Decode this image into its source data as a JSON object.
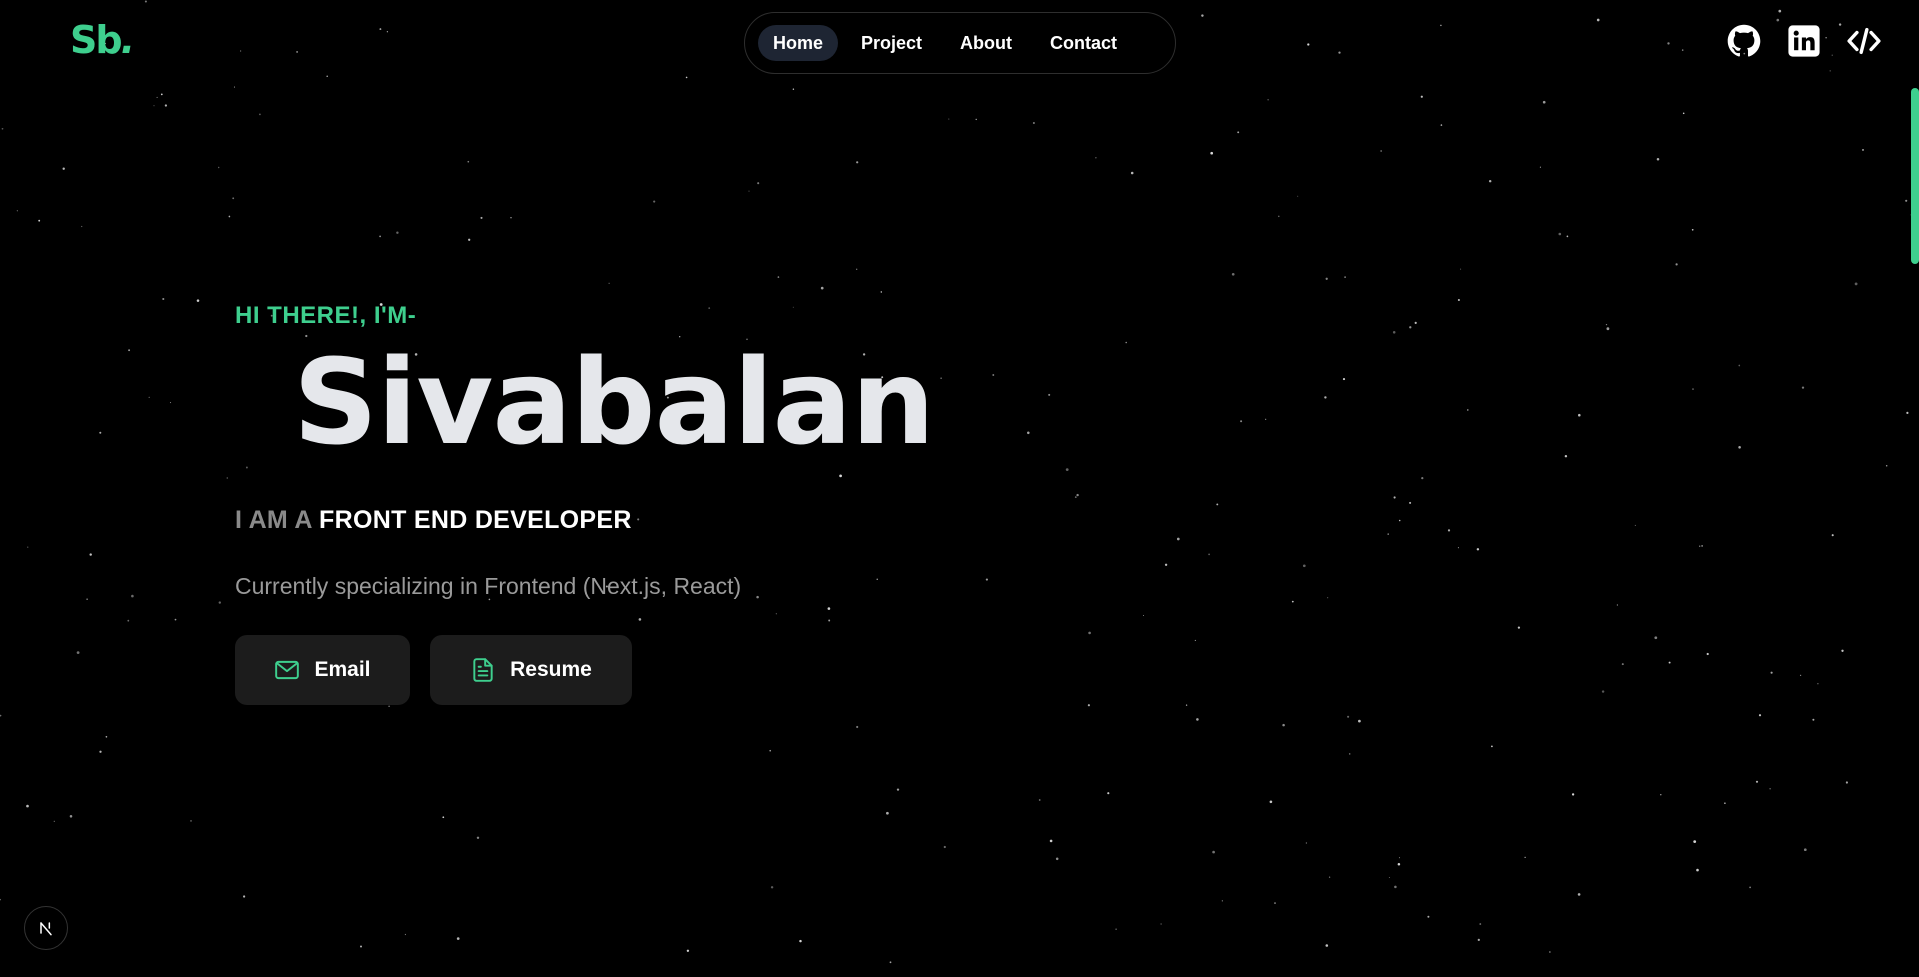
{
  "logo": {
    "text": "Sb",
    "dot": "."
  },
  "nav": {
    "items": [
      {
        "label": "Home",
        "active": true
      },
      {
        "label": "Project",
        "active": false
      },
      {
        "label": "About",
        "active": false
      },
      {
        "label": "Contact",
        "active": false
      }
    ]
  },
  "socials": [
    {
      "icon": "github-icon"
    },
    {
      "icon": "linkedin-icon"
    },
    {
      "icon": "code-icon"
    }
  ],
  "hero": {
    "greeting": "HI THERE!, I'M-",
    "name": "Sivabalan",
    "role_prefix": "I AM A",
    "role_title": "FRONT END DEVELOPER",
    "tagline": "Currently specializing in Frontend (Next.js, React)"
  },
  "buttons": {
    "email": {
      "label": "Email",
      "icon": "mail-icon"
    },
    "resume": {
      "label": "Resume",
      "icon": "document-icon"
    }
  },
  "badge": {
    "icon": "nextjs-icon"
  },
  "colors": {
    "accent": "#3ecf8e",
    "background": "#000000",
    "button_bg": "#1c1c1c",
    "nav_active_bg": "#1e2533",
    "name_color": "#e5e7eb"
  }
}
